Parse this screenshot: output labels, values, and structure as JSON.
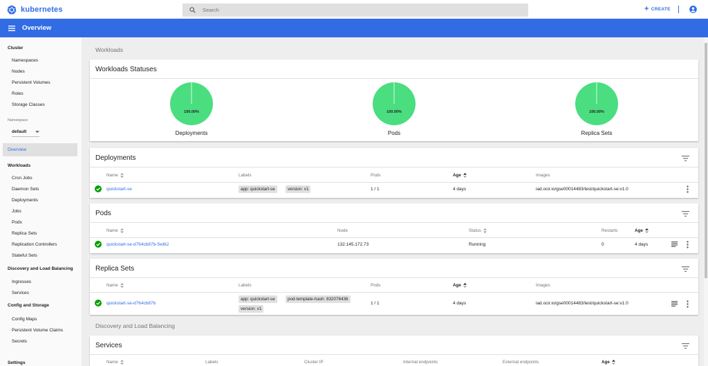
{
  "app": {
    "title": "kubernetes"
  },
  "search": {
    "placeholder": "Search"
  },
  "header": {
    "create_label": "CREATE",
    "page_title": "Overview"
  },
  "sidebar": {
    "cluster_header": "Cluster",
    "cluster_items": [
      "Namespaces",
      "Nodes",
      "Persistent Volumes",
      "Roles",
      "Storage Classes"
    ],
    "namespace_label": "Namespace",
    "namespace_value": "default",
    "overview_label": "Overview",
    "workloads_header": "Workloads",
    "workloads_items": [
      "Cron Jobs",
      "Daemon Sets",
      "Deployments",
      "Jobs",
      "Pods",
      "Replica Sets",
      "Replication Controllers",
      "Stateful Sets"
    ],
    "discovery_header": "Discovery and Load Balancing",
    "discovery_items": [
      "Ingresses",
      "Services"
    ],
    "config_header": "Config and Storage",
    "config_items": [
      "Config Maps",
      "Persistent Volume Claims",
      "Secrets"
    ],
    "settings_header": "Settings"
  },
  "main": {
    "workloads_heading": "Workloads",
    "discovery_heading": "Discovery and Load Balancing"
  },
  "statuses": {
    "title": "Workloads Statuses",
    "charts": [
      {
        "label": "Deployments",
        "percent_text": "100.00%",
        "running_fraction": 1.0
      },
      {
        "label": "Pods",
        "percent_text": "100.00%",
        "running_fraction": 1.0
      },
      {
        "label": "Replica Sets",
        "percent_text": "100.00%",
        "running_fraction": 1.0
      }
    ]
  },
  "deployments": {
    "title": "Deployments",
    "columns": {
      "name": "Name",
      "labels": "Labels",
      "pods": "Pods",
      "age": "Age",
      "images": "Images"
    },
    "row": {
      "name": "quickstart-se",
      "labels": [
        "app: quickstart-se",
        "version: v1"
      ],
      "pods": "1 / 1",
      "age": "4 days",
      "images": "iad.ocir.io/gse00014483/test/quickstart-se:v1.0"
    }
  },
  "pods": {
    "title": "Pods",
    "columns": {
      "name": "Name",
      "node": "Node",
      "status": "Status",
      "restarts": "Restarts",
      "age": "Age"
    },
    "row": {
      "name": "quickstart-se-d764cb87b-5wtk2",
      "node": "132.145.172.73",
      "status": "Running",
      "restarts": "0",
      "age": "4 days"
    }
  },
  "replica_sets": {
    "title": "Replica Sets",
    "columns": {
      "name": "Name",
      "labels": "Labels",
      "pods": "Pods",
      "age": "Age",
      "images": "Images"
    },
    "row": {
      "name": "quickstart-se-d764cb87b",
      "labels": [
        "app: quickstart-se",
        "pod-template-hash: 832076436",
        "version: v1"
      ],
      "pods": "1 / 1",
      "age": "4 days",
      "images": "iad.ocir.io/gse00014483/test/quickstart-se:v1.0"
    }
  },
  "services": {
    "title": "Services",
    "columns": {
      "name": "Name",
      "labels": "Labels",
      "cluster_ip": "Cluster IP",
      "internal": "Internal endpoints",
      "external": "External endpoints",
      "age": "Age"
    }
  },
  "colors": {
    "accent": "#326ce5",
    "success": "#00a000",
    "chart_fill": "#4ade80"
  }
}
